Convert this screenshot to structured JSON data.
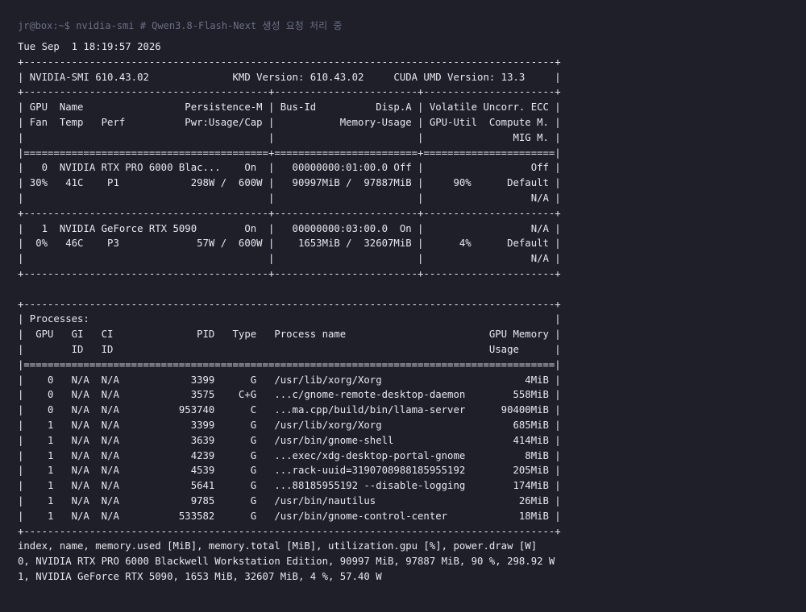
{
  "terminal": {
    "prompt_line": "jr@box:~$ nvidia-smi # Qwen3.8-Flash-Next 생성 요청 처리 중",
    "colors": {
      "background": "#1e1f29",
      "text": "#e8e8ee",
      "prompt": "#6b6f85"
    },
    "output": "Tue Sep  1 18:19:57 2026\n+-----------------------------------------------------------------------------------------+\n| NVIDIA-SMI 610.43.02              KMD Version: 610.43.02     CUDA UMD Version: 13.3     |\n+-----------------------------------------+------------------------+----------------------+\n| GPU  Name                 Persistence-M | Bus-Id          Disp.A | Volatile Uncorr. ECC |\n| Fan  Temp   Perf          Pwr:Usage/Cap |           Memory-Usage | GPU-Util  Compute M. |\n|                                         |                        |               MIG M. |\n|=========================================+========================+======================|\n|   0  NVIDIA RTX PRO 6000 Blac...    On  |   00000000:01:00.0 Off |                  Off |\n| 30%   41C    P1            298W /  600W |   90997MiB /  97887MiB |     90%      Default |\n|                                         |                        |                  N/A |\n+-----------------------------------------+------------------------+----------------------+\n|   1  NVIDIA GeForce RTX 5090        On  |   00000000:03:00.0  On |                  N/A |\n|  0%   46C    P3             57W /  600W |    1653MiB /  32607MiB |      4%      Default |\n|                                         |                        |                  N/A |\n+-----------------------------------------+------------------------+----------------------+\n\n+-----------------------------------------------------------------------------------------+\n| Processes:                                                                              |\n|  GPU   GI   CI              PID   Type   Process name                        GPU Memory |\n|        ID   ID                                                               Usage      |\n|=========================================================================================|\n|    0   N/A  N/A            3399      G   /usr/lib/xorg/Xorg                        4MiB |\n|    0   N/A  N/A            3575    C+G   ...c/gnome-remote-desktop-daemon        558MiB |\n|    0   N/A  N/A          953740      C   ...ma.cpp/build/bin/llama-server      90400MiB |\n|    1   N/A  N/A            3399      G   /usr/lib/xorg/Xorg                      685MiB |\n|    1   N/A  N/A            3639      G   /usr/bin/gnome-shell                    414MiB |\n|    1   N/A  N/A            4239      G   ...exec/xdg-desktop-portal-gnome          8MiB |\n|    1   N/A  N/A            4539      G   ...rack-uuid=3190708988185955192        205MiB |\n|    1   N/A  N/A            5641      G   ...88185955192 --disable-logging        174MiB |\n|    1   N/A  N/A            9785      G   /usr/bin/nautilus                        26MiB |\n|    1   N/A  N/A          533582      G   /usr/bin/gnome-control-center            18MiB |\n+-----------------------------------------------------------------------------------------+\nindex, name, memory.used [MiB], memory.total [MiB], utilization.gpu [%], power.draw [W]\n0, NVIDIA RTX PRO 6000 Blackwell Workstation Edition, 90997 MiB, 97887 MiB, 90 %, 298.92 W\n1, NVIDIA GeForce RTX 5090, 1653 MiB, 32607 MiB, 4 %, 57.40 W"
  }
}
